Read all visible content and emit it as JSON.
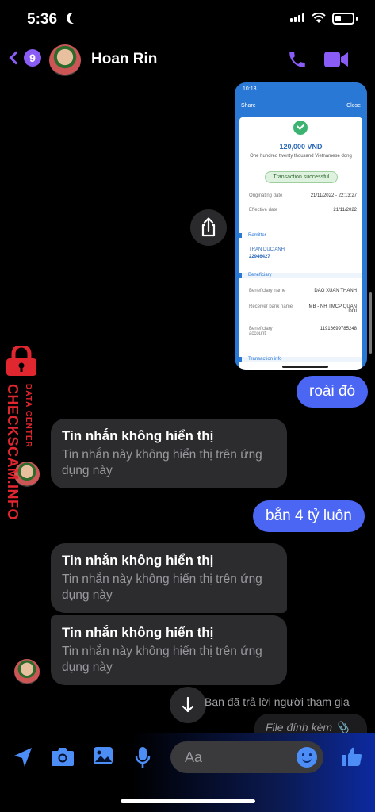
{
  "status_bar": {
    "time": "5:36"
  },
  "header": {
    "unread_count": "9",
    "contact_name": "Hoan Rin"
  },
  "shared_image": {
    "phone_time": "10:13",
    "share_label": "Share",
    "close_label": "Close",
    "amount": "120,000 VND",
    "amount_words": "One hundred twenty thousand Vietnamese dong",
    "status": "Transaction successful",
    "originating_label": "Originating date",
    "originating_value": "21/11/2022 - 22:13:27",
    "effective_label": "Effective date",
    "effective_value": "21/11/2022",
    "remitter_section": "Remitter",
    "remitter_name": "TRAN DUC ANH",
    "remitter_account": "22946427",
    "beneficiary_section": "Beneficiary",
    "beneficiary_name_label": "Beneficiary name",
    "beneficiary_name_value": "DAO XUAN THANH",
    "receiver_bank_label": "Receiver bank name",
    "receiver_bank_value": "MB - NH TMCP QUAN DOI",
    "beneficiary_account_label": "Beneficiary account",
    "beneficiary_account_value": "11916699785248",
    "transaction_info_section": "Transaction info"
  },
  "messages": {
    "out_1": "roài đó",
    "hidden_title": "Tin nhắn không hiển thị",
    "hidden_desc": "Tin nhắn này không hiển thị trên ứng dụng này",
    "out_2": "bắn 4 tỷ luôn"
  },
  "watermark": {
    "brand": "CHECKSCAM.INFO",
    "sub": "DATA CENTER"
  },
  "replied_notice": "Bạn đã trả lời người tham gia",
  "attachment_label": "File đính kèm",
  "composer": {
    "placeholder": "Aa"
  },
  "colors": {
    "accent": "#8a5cf6",
    "outgoing_bubble": "#4c66f4",
    "incoming_bubble": "#2c2c2e",
    "watermark": "#e0262f"
  }
}
